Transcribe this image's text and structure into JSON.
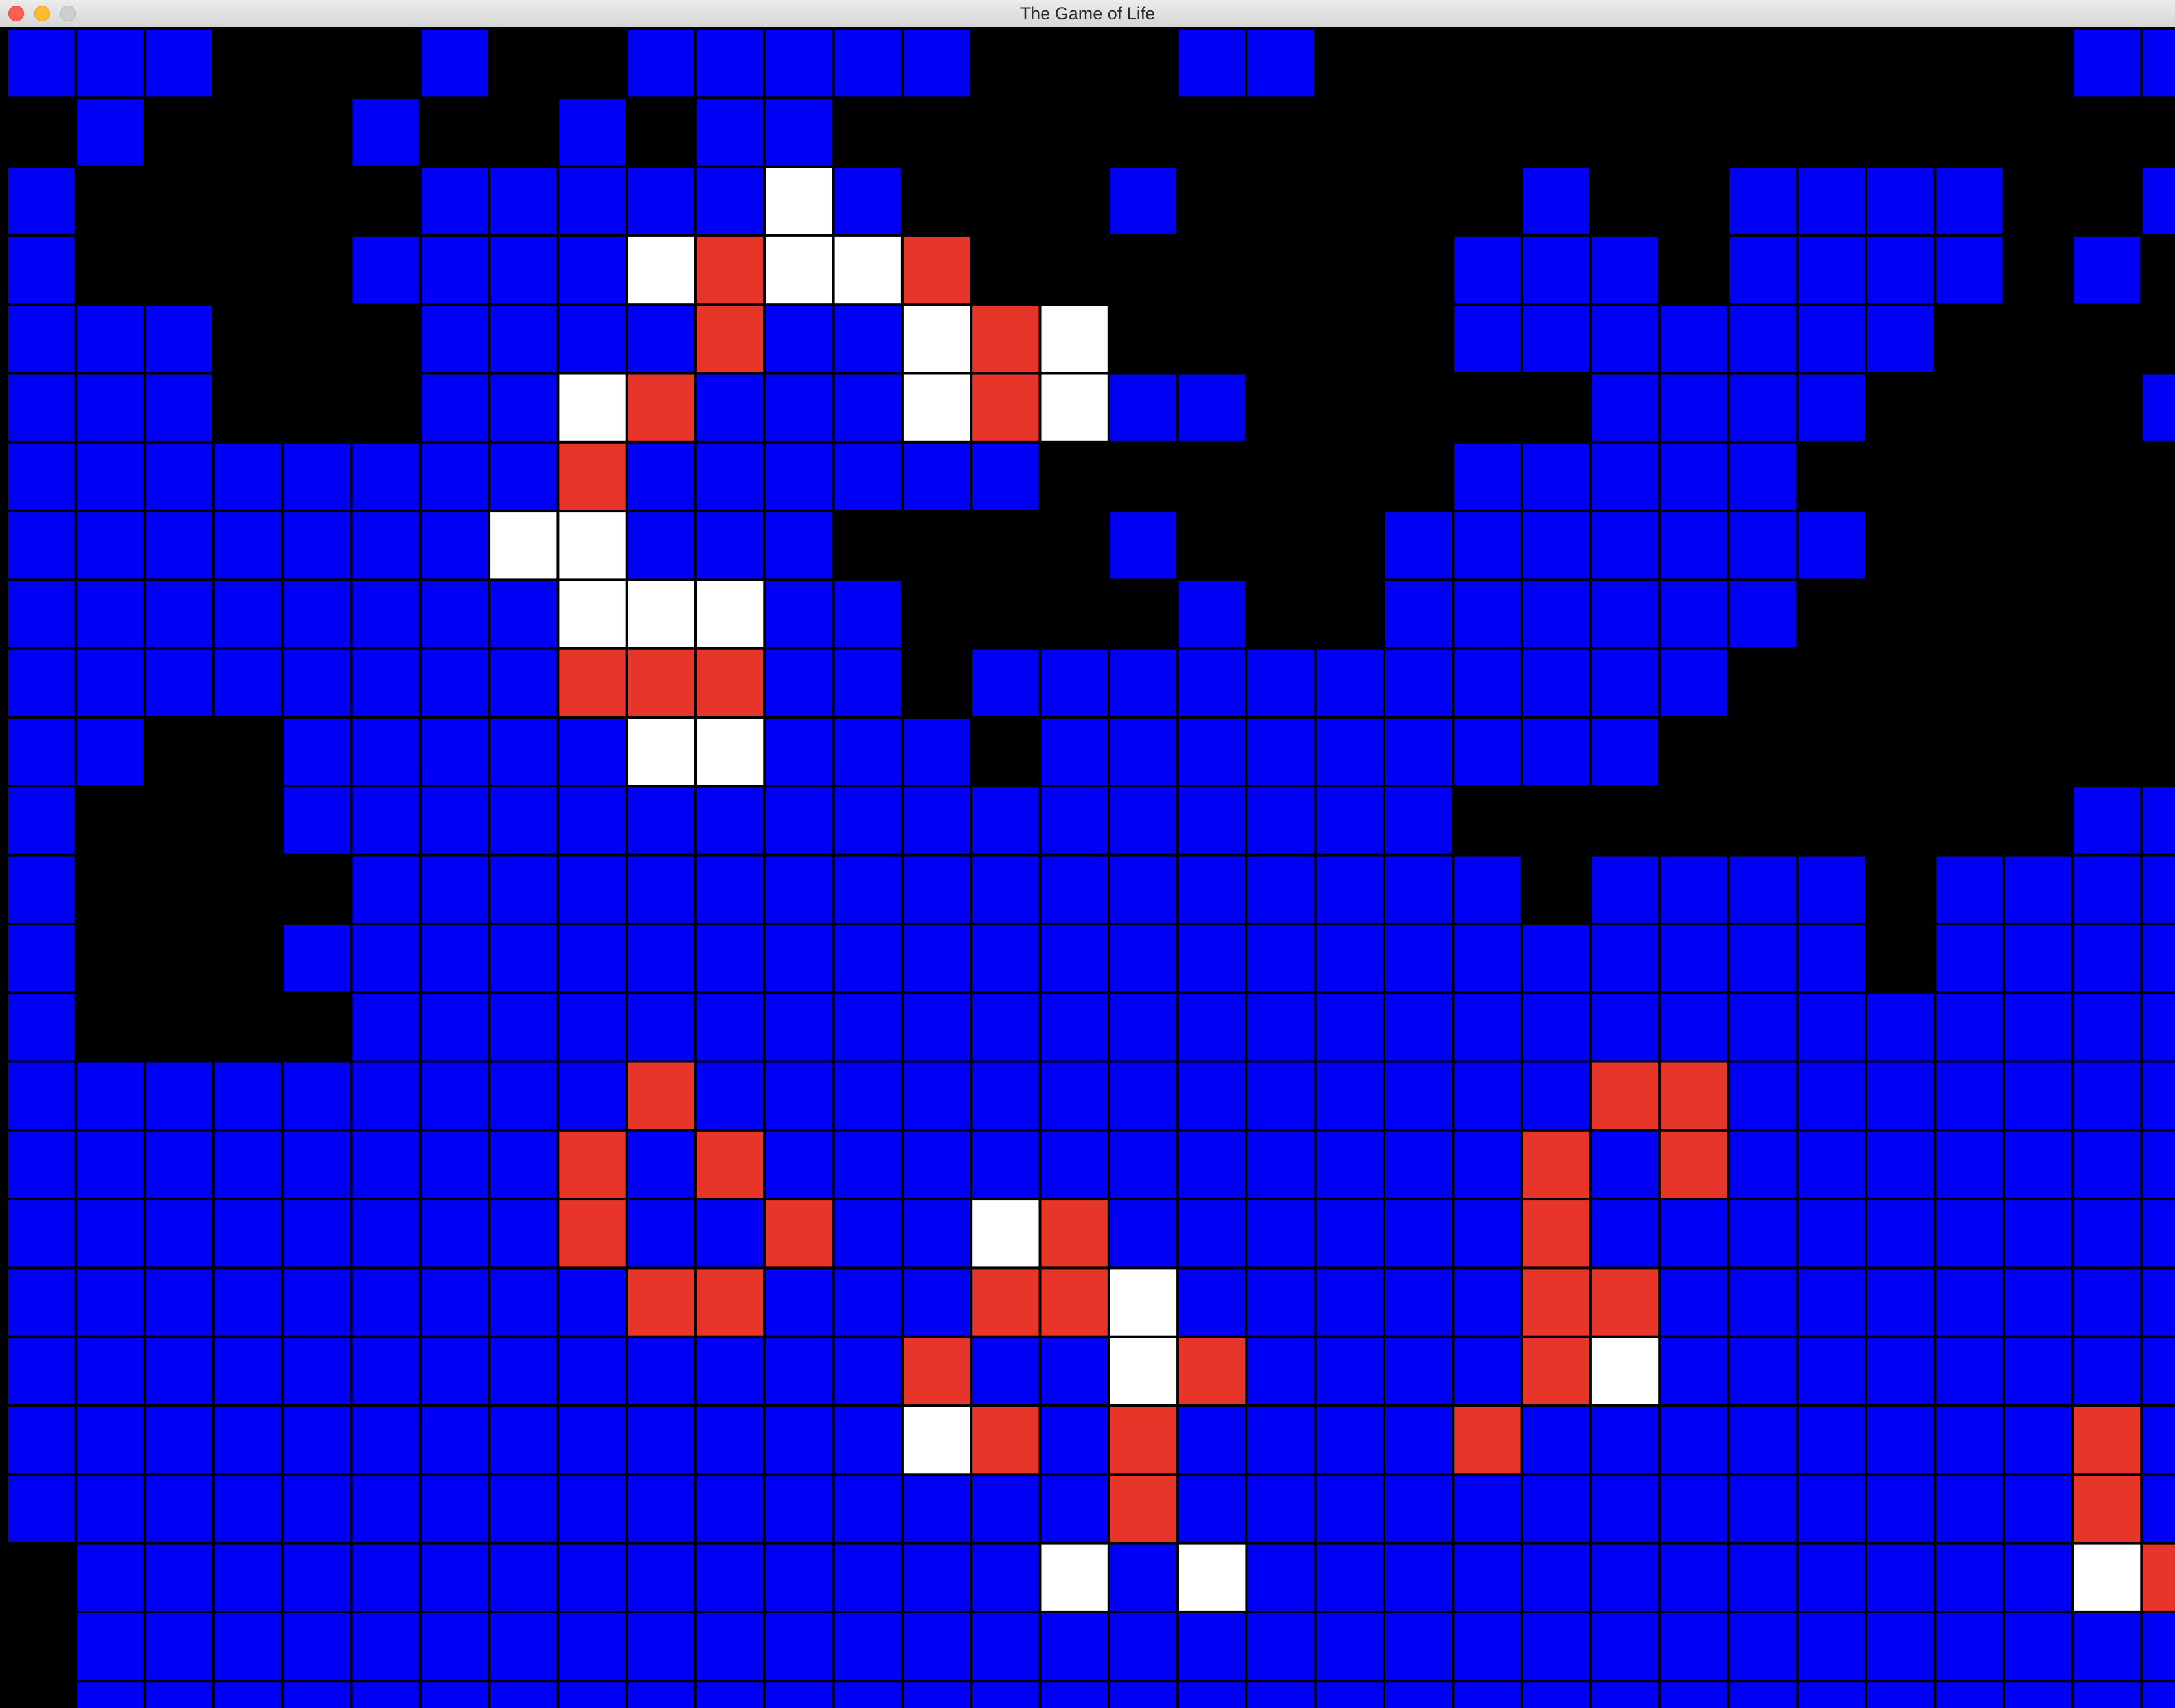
{
  "window": {
    "title": "The Game of Life"
  },
  "colors": {
    "background": "#000000",
    "alive": "#0000f5",
    "born": "#ffffff",
    "dying": "#e8352a",
    "grid": "#000000"
  },
  "legend_codes": {
    ".": "dead",
    "B": "alive",
    "W": "born",
    "R": "dying"
  },
  "board": {
    "columns": 32,
    "visible_rows": 25,
    "rows": [
      "BBB...B..BBBBB...BB...........BBBB",
      ".B...B..B.BB.....................BBBB.",
      "B.....BBBBBWB...B.....B..BBBB..",
      "B....BBBBWRWWR.......BBB.BBBB.B.",
      "BBB...BBBBRBBWRW.....BBBBBBB....",
      "BBB...BBWRBBBWRWBB.....BBBB....B",
      "BBBBBBBBRBBBBBB......BBBBB......",
      "BBBBBBBWWBBB....B...BBBBBBB.....",
      "BBBBBBBBWWWBB....B..BBBBBB......",
      "BBBBBBBBRRRBB.BBBBBBBBBBB.......",
      "BB..BBBBBWWBBB.BBBBBBBBB........",
      "B...BBBBBBBBBBBBBBBBB.........BB",
      "B....BBBBBBBBBBBBBBBBB.BBBB.BBBB",
      "B...BBBBBBBBBBBBBBBBBBBBBBB.BBBB",
      "B....BBBBBBBBBBBBBBBBBBBBBBBBBBB",
      "BBBBBBBBBRBBBBBBBBBBBBBRRBBBBBBB",
      "BBBBBBBBRBRBBBBBBBBBBBRBRBBBBBBB",
      "BBBBBBBBRBBRBBWRBBBBBBRBBBBBBBBB",
      "BBBBBBBBBRRBBBRRWBBBBBRRBBBBBBBB",
      "BBBBBBBBBBBBBRBBWRBBBBRWBBBBBBBB",
      "BBBBBBBBBBBBBWRBRBBBBRBBBBBBBBRB",
      "BBBBBBBBBBBBBBBBRBBBBBBBBBBBBBRB",
      ".BBBBBBBBBBBBBBWBWBBBBBBBBBBBBWR",
      ".BBBBBBBBBBBBBBBBBBBBBBBBBBBBBBB",
      ".BBBBBBBBBBBBBBBBBBBBBBBBBBBBBBB"
    ]
  }
}
